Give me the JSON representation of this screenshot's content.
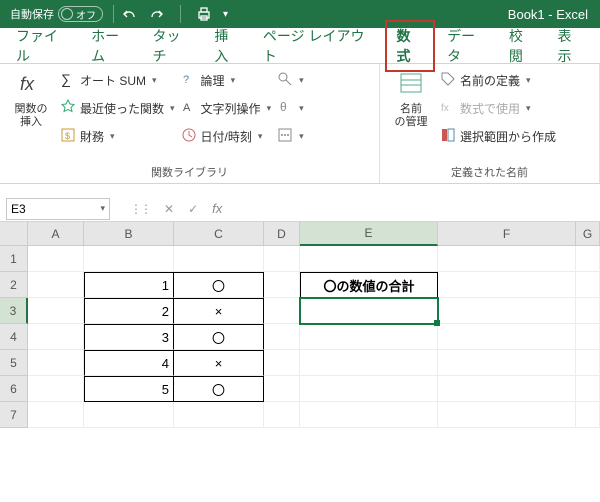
{
  "title_bar": {
    "autosave_label": "自動保存",
    "autosave_state": "オフ",
    "doc_title": "Book1  -  Excel"
  },
  "tabs": {
    "file": "ファイル",
    "home": "ホーム",
    "touch": "タッチ",
    "insert": "挿入",
    "pagelayout": "ページ レイアウト",
    "formulas": "数式",
    "data": "データ",
    "review": "校閲",
    "view": "表示"
  },
  "ribbon": {
    "insert_fn_line1": "関数の",
    "insert_fn_line2": "挿入",
    "autosum": "オート SUM",
    "recent": "最近使った関数",
    "financial": "財務",
    "logical": "論理",
    "text": "文字列操作",
    "datetime": "日付/時刻",
    "group1_title": "関数ライブラリ",
    "name_mgr_line1": "名前",
    "name_mgr_line2": "の管理",
    "define_name": "名前の定義",
    "use_in_formula": "数式で使用",
    "create_from_sel": "選択範囲から作成",
    "group2_title": "定義された名前"
  },
  "name_box": "E3",
  "headers": {
    "A": "A",
    "B": "B",
    "C": "C",
    "D": "D",
    "E": "E",
    "F": "F",
    "G": "G"
  },
  "rows": {
    "1": "1",
    "2": "2",
    "3": "3",
    "4": "4",
    "5": "5",
    "6": "6",
    "7": "7"
  },
  "cells": {
    "B2": "1",
    "C2": "〇",
    "B3": "2",
    "C3": "×",
    "B4": "3",
    "C4": "〇",
    "B5": "4",
    "C5": "×",
    "B6": "5",
    "C6": "〇",
    "E2": "〇の数値の合計"
  }
}
